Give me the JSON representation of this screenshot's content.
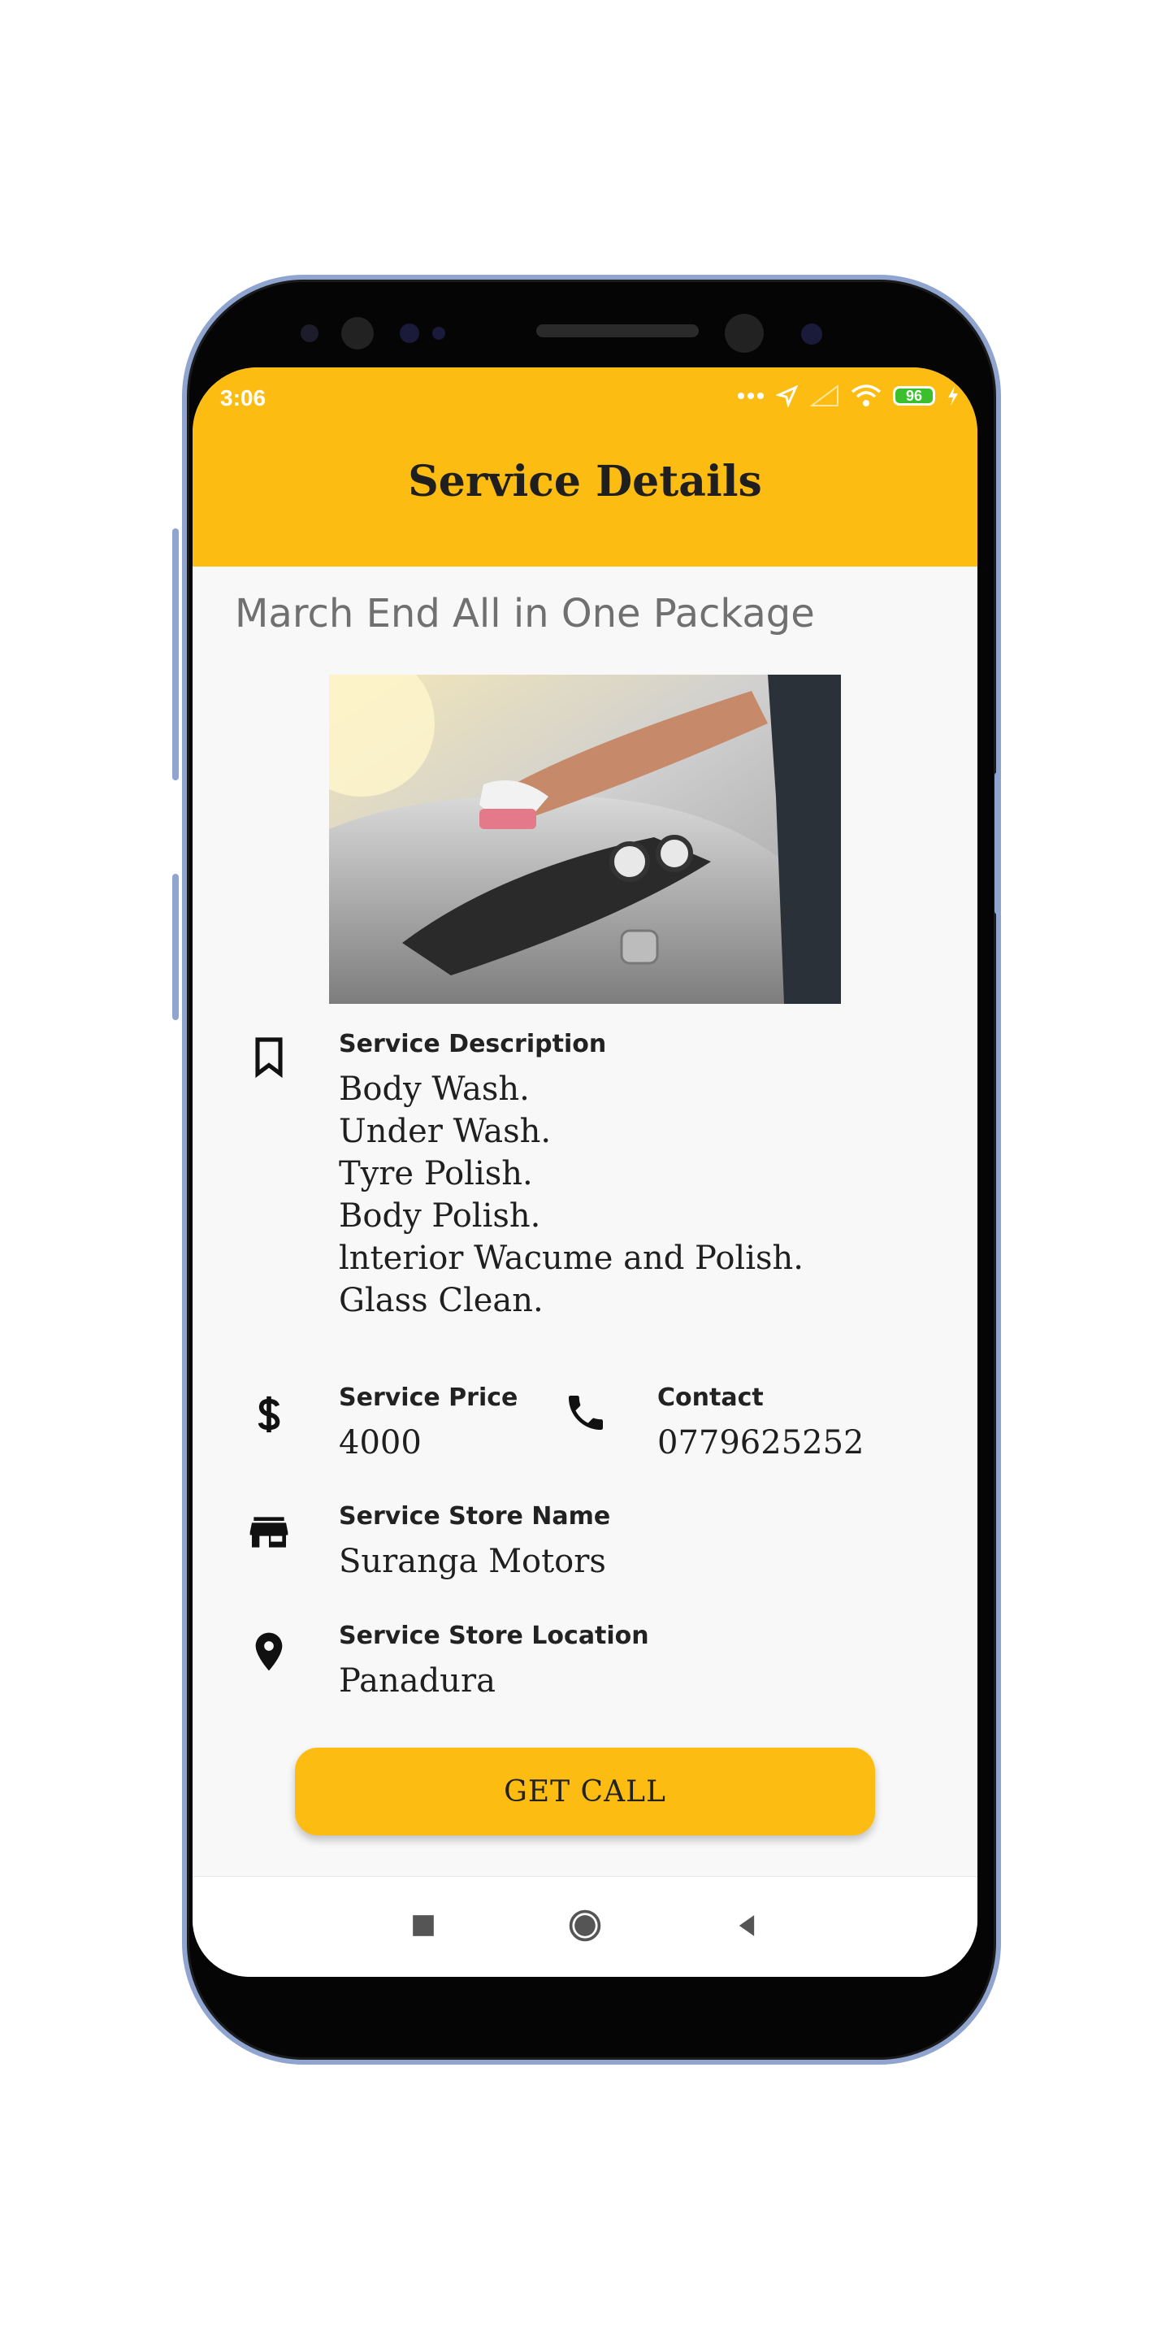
{
  "status_bar": {
    "time": "3:06",
    "battery": "96",
    "icons": [
      "more-dots-icon",
      "location-arrow-icon",
      "signal-icon",
      "wifi-icon",
      "battery-icon",
      "charging-icon"
    ]
  },
  "app_bar": {
    "title": "Service Details"
  },
  "package": {
    "title": "March End All in One Package"
  },
  "description": {
    "label": "Service Description",
    "lines": [
      "Body Wash.",
      "Under Wash.",
      "Tyre Polish.",
      "Body Polish.",
      "lnterior Wacume and Polish.",
      "Glass Clean."
    ]
  },
  "price": {
    "label": "Service Price",
    "value": "4000"
  },
  "contact": {
    "label": "Contact",
    "value": "0779625252"
  },
  "store": {
    "label": "Service Store Name",
    "value": "Suranga Motors"
  },
  "location": {
    "label": "Service Store Location",
    "value": "Panadura"
  },
  "cta": {
    "label": "GET CALL"
  },
  "colors": {
    "accent": "#fdbc12",
    "background": "#f8f8f8",
    "frame": "#8fa4cf"
  }
}
